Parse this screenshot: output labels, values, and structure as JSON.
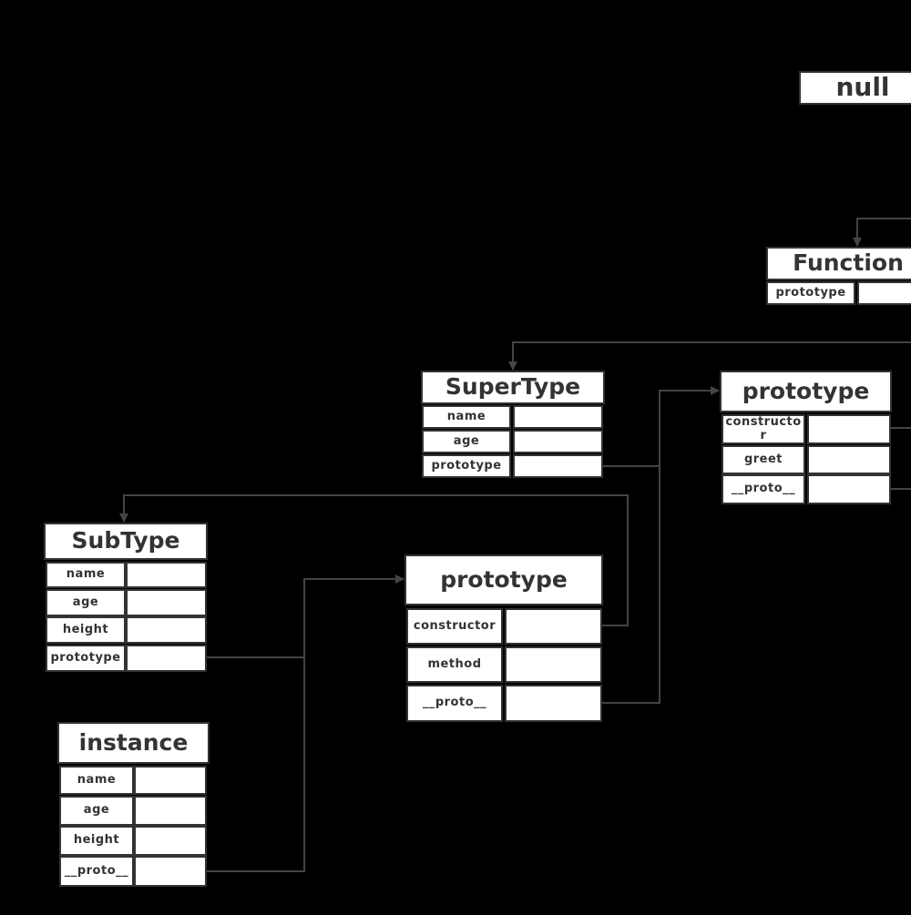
{
  "diagram": {
    "line_color": "#444444",
    "box_fill": "#ffffff",
    "background": "#000000",
    "boxes": {
      "null_box": {
        "title": "null",
        "rows": []
      },
      "function_box": {
        "title": "Function",
        "rows": [
          "prototype"
        ]
      },
      "supertype_box": {
        "title": "SuperType",
        "rows": [
          "name",
          "age",
          "prototype"
        ]
      },
      "supertype_prototype_box": {
        "title": "prototype",
        "rows": [
          "constructor",
          "greet",
          "__proto__"
        ]
      },
      "subtype_box": {
        "title": "SubType",
        "rows": [
          "name",
          "age",
          "height",
          "prototype"
        ]
      },
      "subtype_prototype_box": {
        "title": "prototype",
        "rows": [
          "constructor",
          "method",
          "__proto__"
        ]
      },
      "instance_box": {
        "title": "instance",
        "rows": [
          "name",
          "age",
          "height",
          "__proto__"
        ]
      }
    }
  }
}
